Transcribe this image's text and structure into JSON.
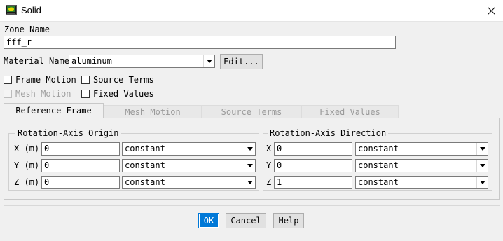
{
  "window": {
    "title": "Solid",
    "close_icon": "close-icon"
  },
  "zone": {
    "label": "Zone Name",
    "value": "fff_r"
  },
  "material": {
    "label": "Material Name",
    "value": "aluminum",
    "edit_label": "Edit..."
  },
  "options": {
    "frame_motion": {
      "label": "Frame Motion",
      "checked": false,
      "enabled": true
    },
    "source_terms": {
      "label": "Source Terms",
      "checked": false,
      "enabled": true
    },
    "mesh_motion": {
      "label": "Mesh Motion",
      "checked": false,
      "enabled": false
    },
    "fixed_values": {
      "label": "Fixed Values",
      "checked": false,
      "enabled": true
    }
  },
  "tabs": [
    {
      "label": "Reference Frame",
      "active": true
    },
    {
      "label": "Mesh Motion",
      "active": false
    },
    {
      "label": "Source Terms",
      "active": false
    },
    {
      "label": "Fixed Values",
      "active": false
    }
  ],
  "origin": {
    "title": "Rotation-Axis Origin",
    "rows": [
      {
        "label": "X (m)",
        "value": "0",
        "method": "constant"
      },
      {
        "label": "Y (m)",
        "value": "0",
        "method": "constant"
      },
      {
        "label": "Z (m)",
        "value": "0",
        "method": "constant"
      }
    ]
  },
  "direction": {
    "title": "Rotation-Axis Direction",
    "rows": [
      {
        "label": "X",
        "value": "0",
        "method": "constant"
      },
      {
        "label": "Y",
        "value": "0",
        "method": "constant"
      },
      {
        "label": "Z",
        "value": "1",
        "method": "constant"
      }
    ]
  },
  "buttons": {
    "ok": "OK",
    "cancel": "Cancel",
    "help": "Help"
  },
  "colors": {
    "accent": "#0078d7",
    "window_bg": "#f0f0f0"
  }
}
